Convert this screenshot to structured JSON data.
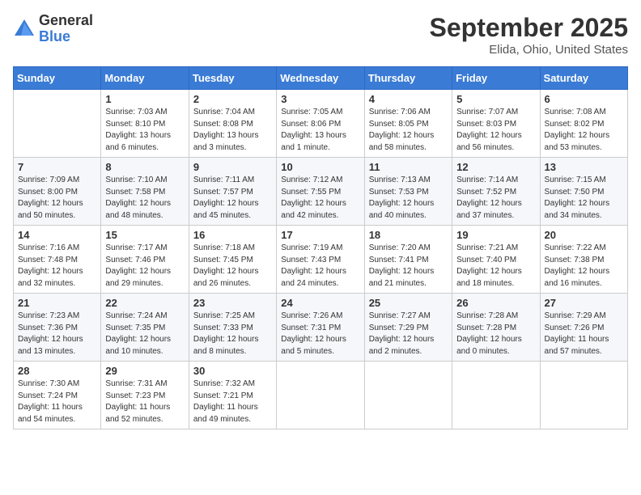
{
  "header": {
    "logo_general": "General",
    "logo_blue": "Blue",
    "month": "September 2025",
    "location": "Elida, Ohio, United States"
  },
  "weekdays": [
    "Sunday",
    "Monday",
    "Tuesday",
    "Wednesday",
    "Thursday",
    "Friday",
    "Saturday"
  ],
  "weeks": [
    [
      {
        "day": "",
        "info": ""
      },
      {
        "day": "1",
        "info": "Sunrise: 7:03 AM\nSunset: 8:10 PM\nDaylight: 13 hours\nand 6 minutes."
      },
      {
        "day": "2",
        "info": "Sunrise: 7:04 AM\nSunset: 8:08 PM\nDaylight: 13 hours\nand 3 minutes."
      },
      {
        "day": "3",
        "info": "Sunrise: 7:05 AM\nSunset: 8:06 PM\nDaylight: 13 hours\nand 1 minute."
      },
      {
        "day": "4",
        "info": "Sunrise: 7:06 AM\nSunset: 8:05 PM\nDaylight: 12 hours\nand 58 minutes."
      },
      {
        "day": "5",
        "info": "Sunrise: 7:07 AM\nSunset: 8:03 PM\nDaylight: 12 hours\nand 56 minutes."
      },
      {
        "day": "6",
        "info": "Sunrise: 7:08 AM\nSunset: 8:02 PM\nDaylight: 12 hours\nand 53 minutes."
      }
    ],
    [
      {
        "day": "7",
        "info": "Sunrise: 7:09 AM\nSunset: 8:00 PM\nDaylight: 12 hours\nand 50 minutes."
      },
      {
        "day": "8",
        "info": "Sunrise: 7:10 AM\nSunset: 7:58 PM\nDaylight: 12 hours\nand 48 minutes."
      },
      {
        "day": "9",
        "info": "Sunrise: 7:11 AM\nSunset: 7:57 PM\nDaylight: 12 hours\nand 45 minutes."
      },
      {
        "day": "10",
        "info": "Sunrise: 7:12 AM\nSunset: 7:55 PM\nDaylight: 12 hours\nand 42 minutes."
      },
      {
        "day": "11",
        "info": "Sunrise: 7:13 AM\nSunset: 7:53 PM\nDaylight: 12 hours\nand 40 minutes."
      },
      {
        "day": "12",
        "info": "Sunrise: 7:14 AM\nSunset: 7:52 PM\nDaylight: 12 hours\nand 37 minutes."
      },
      {
        "day": "13",
        "info": "Sunrise: 7:15 AM\nSunset: 7:50 PM\nDaylight: 12 hours\nand 34 minutes."
      }
    ],
    [
      {
        "day": "14",
        "info": "Sunrise: 7:16 AM\nSunset: 7:48 PM\nDaylight: 12 hours\nand 32 minutes."
      },
      {
        "day": "15",
        "info": "Sunrise: 7:17 AM\nSunset: 7:46 PM\nDaylight: 12 hours\nand 29 minutes."
      },
      {
        "day": "16",
        "info": "Sunrise: 7:18 AM\nSunset: 7:45 PM\nDaylight: 12 hours\nand 26 minutes."
      },
      {
        "day": "17",
        "info": "Sunrise: 7:19 AM\nSunset: 7:43 PM\nDaylight: 12 hours\nand 24 minutes."
      },
      {
        "day": "18",
        "info": "Sunrise: 7:20 AM\nSunset: 7:41 PM\nDaylight: 12 hours\nand 21 minutes."
      },
      {
        "day": "19",
        "info": "Sunrise: 7:21 AM\nSunset: 7:40 PM\nDaylight: 12 hours\nand 18 minutes."
      },
      {
        "day": "20",
        "info": "Sunrise: 7:22 AM\nSunset: 7:38 PM\nDaylight: 12 hours\nand 16 minutes."
      }
    ],
    [
      {
        "day": "21",
        "info": "Sunrise: 7:23 AM\nSunset: 7:36 PM\nDaylight: 12 hours\nand 13 minutes."
      },
      {
        "day": "22",
        "info": "Sunrise: 7:24 AM\nSunset: 7:35 PM\nDaylight: 12 hours\nand 10 minutes."
      },
      {
        "day": "23",
        "info": "Sunrise: 7:25 AM\nSunset: 7:33 PM\nDaylight: 12 hours\nand 8 minutes."
      },
      {
        "day": "24",
        "info": "Sunrise: 7:26 AM\nSunset: 7:31 PM\nDaylight: 12 hours\nand 5 minutes."
      },
      {
        "day": "25",
        "info": "Sunrise: 7:27 AM\nSunset: 7:29 PM\nDaylight: 12 hours\nand 2 minutes."
      },
      {
        "day": "26",
        "info": "Sunrise: 7:28 AM\nSunset: 7:28 PM\nDaylight: 12 hours\nand 0 minutes."
      },
      {
        "day": "27",
        "info": "Sunrise: 7:29 AM\nSunset: 7:26 PM\nDaylight: 11 hours\nand 57 minutes."
      }
    ],
    [
      {
        "day": "28",
        "info": "Sunrise: 7:30 AM\nSunset: 7:24 PM\nDaylight: 11 hours\nand 54 minutes."
      },
      {
        "day": "29",
        "info": "Sunrise: 7:31 AM\nSunset: 7:23 PM\nDaylight: 11 hours\nand 52 minutes."
      },
      {
        "day": "30",
        "info": "Sunrise: 7:32 AM\nSunset: 7:21 PM\nDaylight: 11 hours\nand 49 minutes."
      },
      {
        "day": "",
        "info": ""
      },
      {
        "day": "",
        "info": ""
      },
      {
        "day": "",
        "info": ""
      },
      {
        "day": "",
        "info": ""
      }
    ]
  ]
}
